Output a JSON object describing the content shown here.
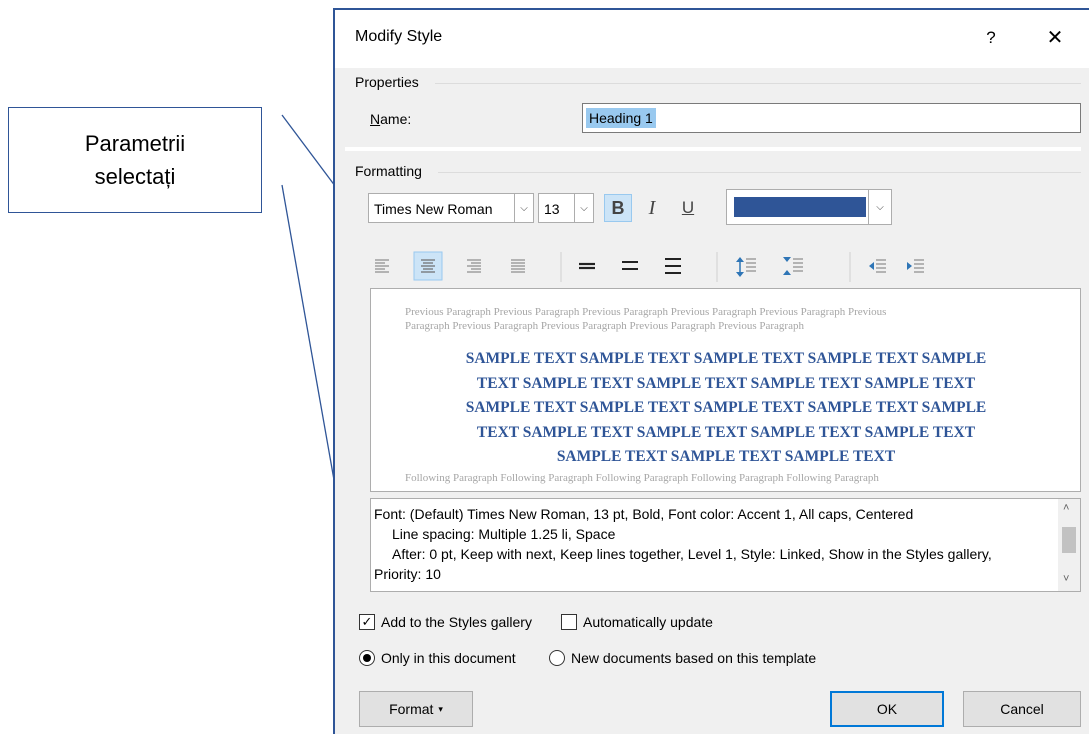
{
  "callout": {
    "line1": "Parametrii",
    "line2": "selectați"
  },
  "dialog": {
    "title": "Modify Style",
    "help_label": "?",
    "close_label": "✕",
    "properties": {
      "group_label": "Properties",
      "name_label": "Name:",
      "name_value": "Heading 1"
    },
    "formatting": {
      "group_label": "Formatting",
      "font": "Times New Roman",
      "size": "13",
      "bold_label": "B",
      "italic_label": "I",
      "underline_label": "U",
      "font_color": "#2f5597",
      "alignment_selected": "center"
    },
    "preview": {
      "previous_line1": "Previous Paragraph Previous Paragraph Previous Paragraph Previous Paragraph Previous Paragraph Previous",
      "previous_line2": "Paragraph Previous Paragraph Previous Paragraph Previous Paragraph Previous Paragraph",
      "sample_lines": [
        "SAMPLE TEXT SAMPLE TEXT SAMPLE TEXT SAMPLE TEXT SAMPLE",
        "TEXT SAMPLE TEXT SAMPLE TEXT SAMPLE TEXT SAMPLE TEXT",
        "SAMPLE TEXT SAMPLE TEXT SAMPLE TEXT SAMPLE TEXT SAMPLE",
        "TEXT SAMPLE TEXT SAMPLE TEXT SAMPLE TEXT SAMPLE TEXT",
        "SAMPLE TEXT SAMPLE TEXT SAMPLE TEXT"
      ],
      "following_line": "Following Paragraph Following Paragraph Following Paragraph Following Paragraph Following Paragraph"
    },
    "description": {
      "line1": "Font: (Default) Times New Roman, 13 pt, Bold, Font color: Accent 1, All caps, Centered",
      "line2": "Line spacing:  Multiple 1.25 li, Space",
      "line3": "After:  0 pt, Keep with next, Keep lines together, Level 1, Style: Linked, Show in the Styles gallery,",
      "line4": "Priority: 10"
    },
    "options": {
      "add_to_gallery_label": "Add to the Styles gallery",
      "add_to_gallery_checked": true,
      "auto_update_label": "Automatically update",
      "auto_update_checked": false,
      "only_this_doc_label": "Only in this document",
      "new_docs_label": "New documents based on this template",
      "selected_scope": "only_this_document"
    },
    "buttons": {
      "format_label": "Format",
      "ok_label": "OK",
      "cancel_label": "Cancel"
    }
  }
}
